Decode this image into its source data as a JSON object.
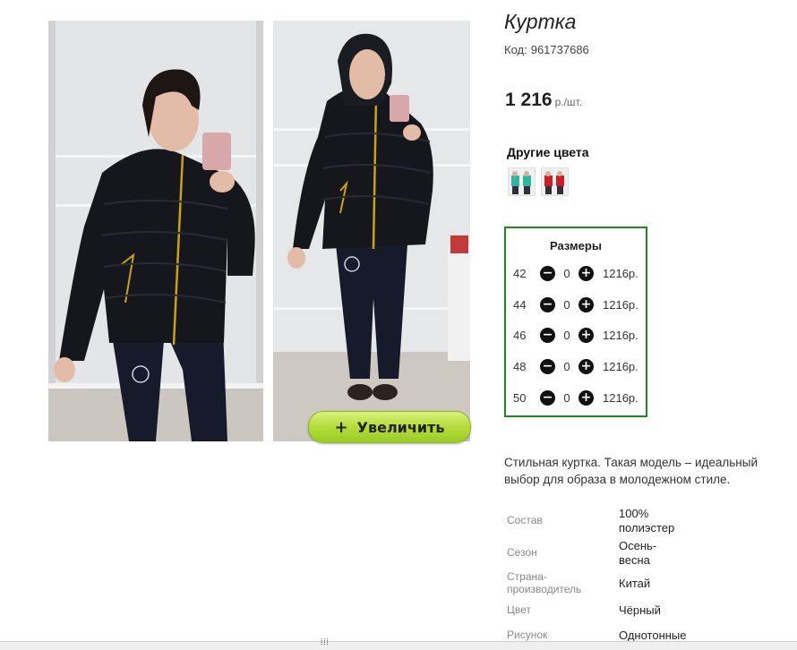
{
  "product": {
    "title": "Куртка",
    "code_label": "Код:",
    "code": "961737686",
    "price": "1 216",
    "price_unit": "р./шт.",
    "zoom_button_icon": "+",
    "zoom_button_label": "Увеличить"
  },
  "other_colors": {
    "title": "Другие цвета"
  },
  "sizes": {
    "title": "Размеры",
    "minus_icon": "−",
    "plus_icon": "+",
    "rows": [
      {
        "size": "42",
        "qty": "0",
        "price": "1216р."
      },
      {
        "size": "44",
        "qty": "0",
        "price": "1216р."
      },
      {
        "size": "46",
        "qty": "0",
        "price": "1216р."
      },
      {
        "size": "48",
        "qty": "0",
        "price": "1216р."
      },
      {
        "size": "50",
        "qty": "0",
        "price": "1216р."
      }
    ]
  },
  "description": "Стильная куртка. Такая модель – идеальный выбор для образа в молодежном стиле.",
  "properties": [
    {
      "label": "Состав",
      "value": "100% полиэстер"
    },
    {
      "label": "Сезон",
      "value": "Осень-весна"
    },
    {
      "label": "Страна-производитель",
      "value": "Китай"
    },
    {
      "label": "Цвет",
      "value": "Чёрный"
    },
    {
      "label": "Рисунок",
      "value": "Однотонные"
    }
  ],
  "colors": {
    "sizes_border": "#1e8a1e",
    "zoom_button": "#b3dc3a",
    "jacket": "#16171c",
    "zipper": "#c9a21a"
  }
}
